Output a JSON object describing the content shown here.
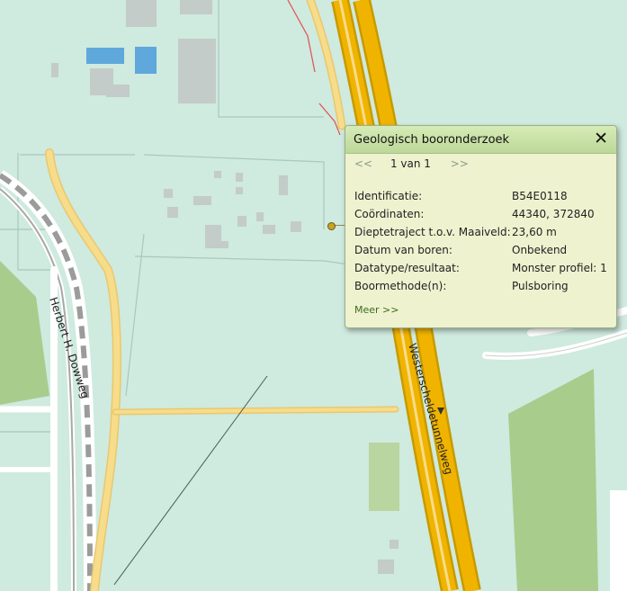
{
  "map": {
    "streets": {
      "herbert": "Herbert H. Dowweg",
      "westerschelde": "Westerscheldetunnelweg"
    },
    "colors": {
      "land": "#cfeadf",
      "building": "#bdc7c3",
      "water": "#5ea8dc",
      "grass": "#a8cc8c",
      "highway": "#f0b400",
      "road": "#f7dc8a",
      "rail": "#9b9b9b",
      "boundary": "#e05050"
    }
  },
  "popup": {
    "title": "Geologisch booronderzoek",
    "close_icon": "close-icon",
    "pager": {
      "prev": "<<",
      "count": "1 van 1",
      "next": ">>"
    },
    "rows": [
      {
        "label": "Identificatie:",
        "value": "B54E0118"
      },
      {
        "label": "Coördinaten:",
        "value": "44340, 372840"
      },
      {
        "label": "Dieptetraject t.o.v. Maaiveld:",
        "value": "23,60 m"
      },
      {
        "label": "Datum van boren:",
        "value": "Onbekend"
      },
      {
        "label": "Datatype/resultaat:",
        "value": "Monster profiel: 1"
      },
      {
        "label": "Boormethode(n):",
        "value": "Pulsboring"
      }
    ],
    "more_link": "Meer >>"
  }
}
